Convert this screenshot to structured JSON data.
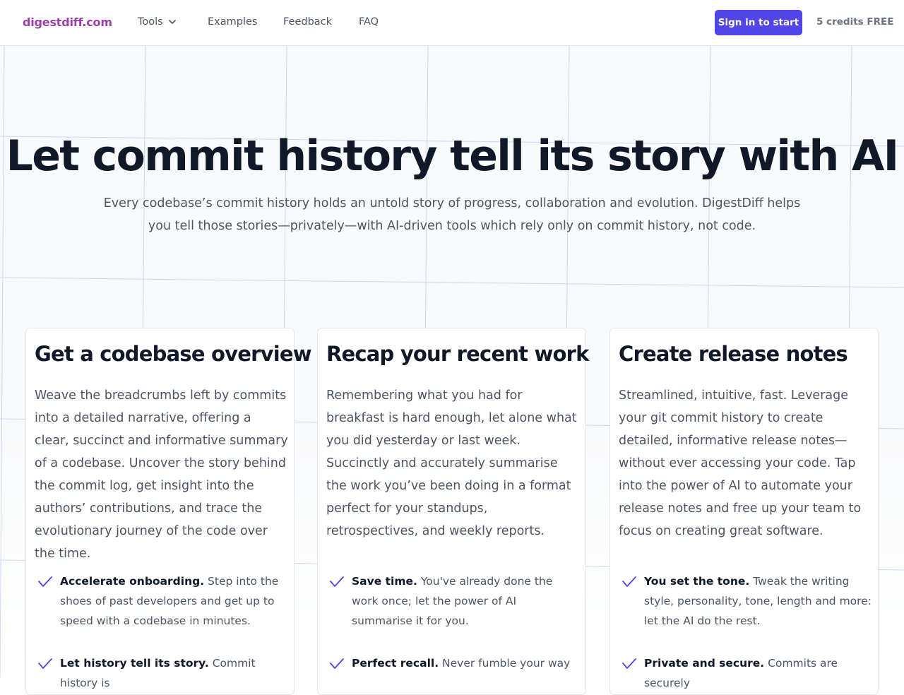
{
  "nav": {
    "brand": "digestdiff.com",
    "tools": "Tools",
    "examples": "Examples",
    "feedback": "Feedback",
    "faq": "FAQ",
    "signin": "Sign in to start",
    "credits": "5 credits FREE"
  },
  "hero": {
    "title": "Let commit history tell its story with AI",
    "subtitle": "Every codebase’s commit history holds an untold story of progress, collaboration and evolution. DigestDiff helps you tell those stories—privately—with AI-driven tools which rely only on commit history, not code."
  },
  "cards": [
    {
      "title": "Get a codebase overview",
      "body": "Weave the breadcrumbs left by commits into a detailed narrative, offering a clear, succinct and informative summary of a codebase. Uncover the story behind the commit log, get insight into the authors’ contributions, and trace the evolutionary journey of the code over the time.",
      "features": [
        {
          "title": "Accelerate onboarding.",
          "text": "Step into the shoes of past developers and get up to speed with a codebase in minutes."
        },
        {
          "title": "Let history tell its story.",
          "text": "Commit history is"
        }
      ]
    },
    {
      "title": "Recap your recent work",
      "body": "Remembering what you had for breakfast is hard enough, let alone what you did yesterday or last week. Succinctly and accurately summarise the work you’ve been doing in a format perfect for your standups, retrospectives, and weekly reports.",
      "features": [
        {
          "title": "Save time.",
          "text": "You've already done the work once; let the power of AI summarise it for you."
        },
        {
          "title": "Perfect recall.",
          "text": "Never fumble your way"
        }
      ]
    },
    {
      "title": "Create release notes",
      "body": "Streamlined, intuitive, fast. Leverage your git commit history to create detailed, informative release notes—without ever accessing your code. Tap into the power of AI to automate your release notes and free up your team to focus on creating great software.",
      "features": [
        {
          "title": "You set the tone.",
          "text": "Tweak the writing style, personality, tone, length and more: let the AI do the rest."
        },
        {
          "title": "Private and secure.",
          "text": "Commits are securely"
        }
      ]
    }
  ],
  "colors": {
    "brand": "#9b3fa8",
    "accent": "#4f46e5",
    "check": "#4f46e5",
    "grid": "#c7cdf5"
  },
  "icons": {
    "tools_caret": "chevron-down-icon",
    "feature": "check-icon"
  }
}
